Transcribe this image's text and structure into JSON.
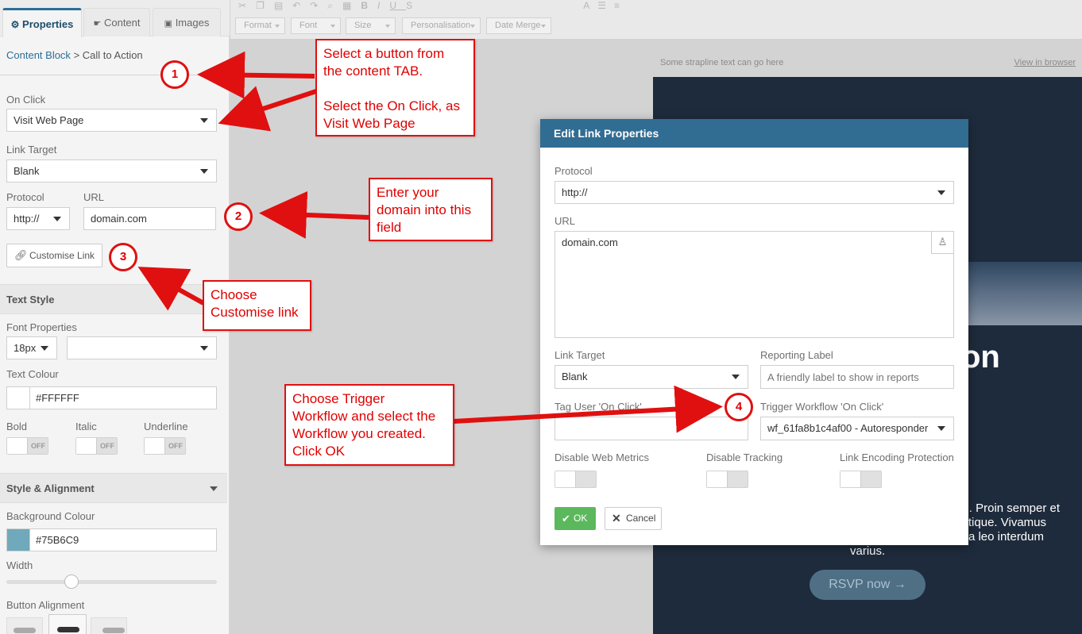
{
  "sidebar": {
    "tabs": [
      {
        "label": "Properties",
        "icon": "gear-icon"
      },
      {
        "label": "Content",
        "icon": "hand-icon"
      },
      {
        "label": "Images",
        "icon": "image-icon"
      }
    ],
    "breadcrumb": {
      "link": "Content Block",
      "sep": ">",
      "current": "Call to Action"
    },
    "on_click": {
      "label": "On Click",
      "value": "Visit Web Page"
    },
    "link_target": {
      "label": "Link Target",
      "value": "Blank"
    },
    "protocol": {
      "label": "Protocol",
      "value": "http://"
    },
    "url": {
      "label": "URL",
      "value": "domain.com"
    },
    "customise_link": "Customise Link",
    "text_style": {
      "heading": "Text Style",
      "font_properties_label": "Font Properties",
      "font_size": "18px",
      "font_family": "",
      "text_colour_label": "Text Colour",
      "text_colour": "#FFFFFF",
      "bold": "Bold",
      "italic": "Italic",
      "underline": "Underline",
      "off": "OFF"
    },
    "style_alignment": {
      "heading": "Style & Alignment",
      "background_colour_label": "Background Colour",
      "background_colour": "#75B6C9",
      "width_label": "Width",
      "width_fraction": 0.31,
      "button_alignment_label": "Button Alignment"
    }
  },
  "toolbar": {
    "format": "Format",
    "font": "Font",
    "size": "Size",
    "personalisation": "Personalisation",
    "date_merge": "Date Merge"
  },
  "email": {
    "strapline": "Some strapline text can go here",
    "view_in_browser": "View in browser",
    "heading_fragment": "on",
    "body_lines": [
      ". Proin semper et",
      "tique. Vivamus",
      "a leo interdum",
      "varius."
    ],
    "rsvp": "RSVP now →"
  },
  "modal": {
    "title": "Edit Link Properties",
    "protocol_label": "Protocol",
    "protocol_value": "http://",
    "url_label": "URL",
    "url_value": "domain.com",
    "link_target_label": "Link Target",
    "link_target_value": "Blank",
    "reporting_label": "Reporting Label",
    "reporting_placeholder": "A friendly label to show in reports",
    "tag_user_label": "Tag User 'On Click'",
    "trigger_label": "Trigger Workflow 'On Click'",
    "trigger_value": "wf_61fa8b1c4af00 - Autoresponder",
    "disable_web_metrics": "Disable Web Metrics",
    "disable_tracking": "Disable Tracking",
    "link_encoding": "Link Encoding Protection",
    "ok": "OK",
    "cancel": "Cancel"
  },
  "annotations": {
    "note1_lines": [
      "Select a button from",
      "the content TAB.",
      "",
      "Select the On Click, as",
      "Visit Web Page"
    ],
    "note2_lines": [
      "Enter your",
      "domain into this",
      "field"
    ],
    "note3_lines": [
      "Choose",
      "Customise link"
    ],
    "note4_lines": [
      "Choose Trigger",
      "Workflow and select the",
      "Workflow you created.",
      "Click OK"
    ],
    "num1": "1",
    "num2": "2",
    "num3": "3",
    "num4": "4"
  },
  "colors": {
    "accent": "#316c92",
    "annotation": "#e01010",
    "ok": "#5cb85c",
    "swatch": "#75B6C9"
  }
}
